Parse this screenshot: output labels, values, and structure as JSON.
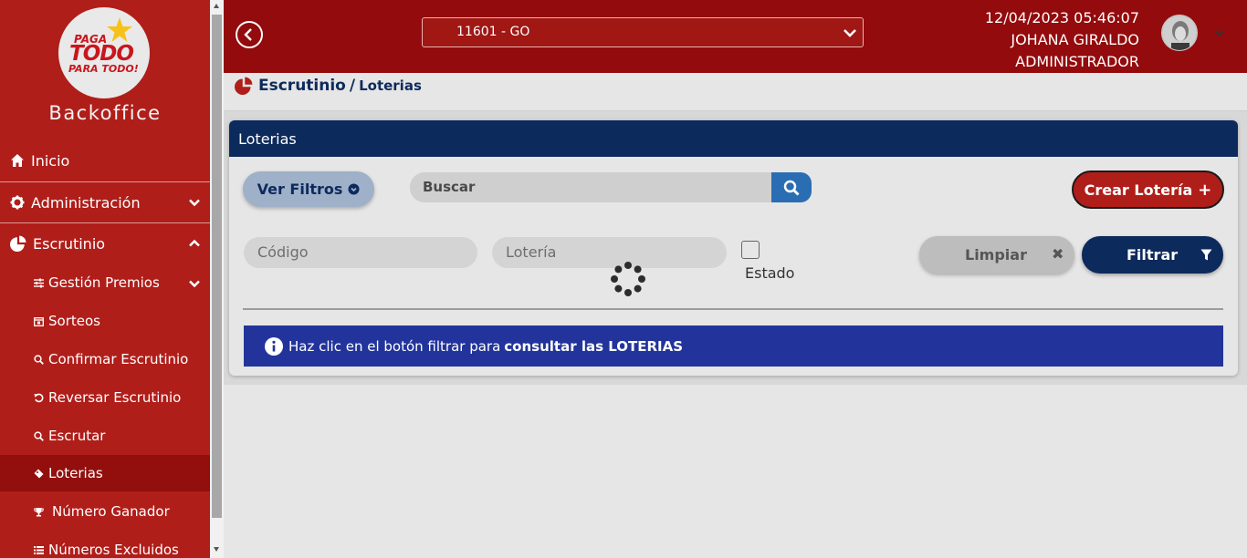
{
  "sidebar": {
    "logo": {
      "line1": "PAGA",
      "line2": "TODO",
      "line3": "PARA TODO!"
    },
    "brand": "Backoffice",
    "items": [
      {
        "label": "Inicio",
        "icon": "home-icon"
      },
      {
        "label": "Administración",
        "icon": "gear-icon"
      },
      {
        "label": "Escrutinio",
        "icon": "pie-chart-icon"
      }
    ],
    "subitems": [
      {
        "label": "Gestión Premios",
        "icon": "sliders-icon"
      },
      {
        "label": "Sorteos",
        "icon": "calendar-icon"
      },
      {
        "label": "Confirmar Escrutinio",
        "icon": "search-check-icon"
      },
      {
        "label": "Reversar Escrutinio",
        "icon": "undo-icon"
      },
      {
        "label": "Escrutar",
        "icon": "search-icon"
      },
      {
        "label": "Loterias",
        "icon": "ticket-icon",
        "active": true
      },
      {
        "label": "Número Ganador",
        "icon": "trophy-icon"
      },
      {
        "label": "Números Excluidos",
        "icon": "list-icon"
      }
    ]
  },
  "header": {
    "branch": "11601 - GO",
    "datetime": "12/04/2023 05:46:07",
    "user_name": "JOHANA GIRALDO",
    "user_role": "ADMINISTRADOR"
  },
  "breadcrumb": {
    "section": "Escrutinio",
    "separator": "/",
    "page": "Loterias"
  },
  "card": {
    "title": "Loterias",
    "filters_button": "Ver Filtros",
    "search_placeholder": "Buscar",
    "create_button": "Crear Lotería",
    "codigo_placeholder": "Código",
    "loteria_placeholder": "Lotería",
    "estado_label": "Estado",
    "clear_button": "Limpiar",
    "filter_button": "Filtrar",
    "info_text": "Haz clic en el botón filtrar para",
    "info_bold": "consultar las LOTERIAS"
  },
  "colors": {
    "sidebar_red": "#b01e1a",
    "header_red": "#930b0d",
    "navy": "#0d2a5c",
    "info_blue": "#22349b",
    "search_blue": "#2a6db2"
  }
}
